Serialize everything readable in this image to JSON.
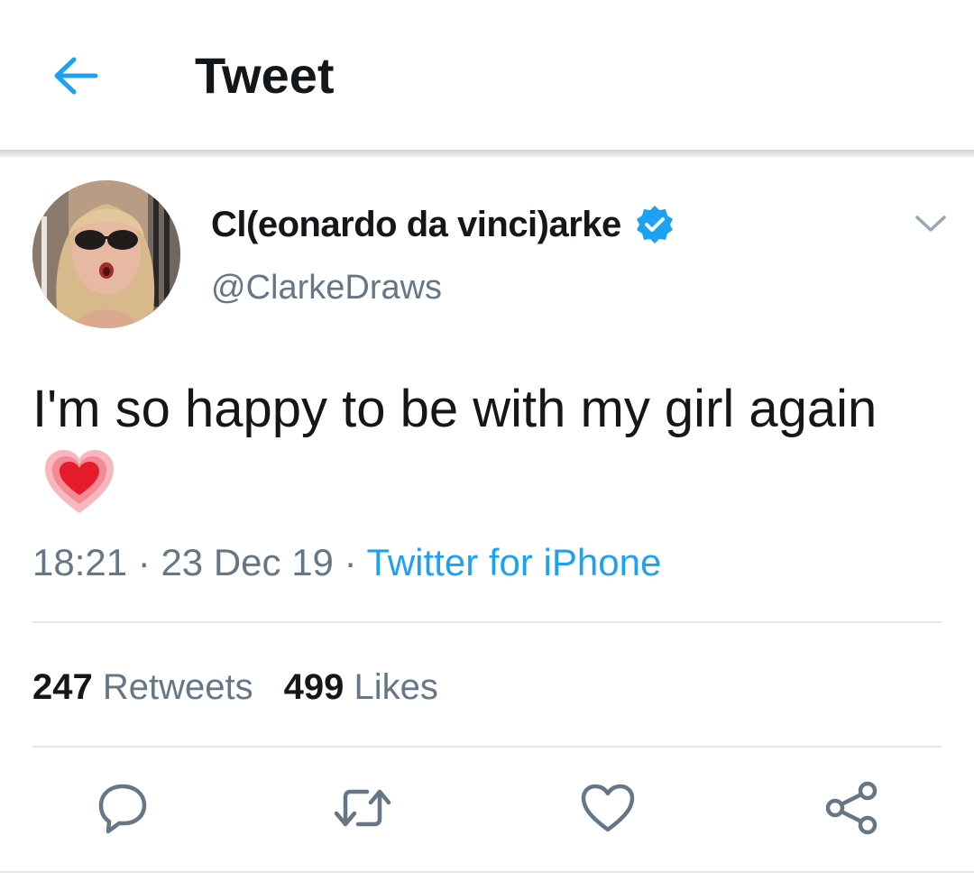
{
  "header": {
    "title": "Tweet",
    "back_icon": "arrow-left-icon"
  },
  "tweet": {
    "author": {
      "display_name": "Cl(eonardo da vinci)arke",
      "handle": "@ClarkeDraws",
      "verified": true
    },
    "text": "I'm so happy to be with my girl again",
    "emoji": "growing-heart-emoji",
    "time": "18:21",
    "separator": "·",
    "date": "23 Dec 19",
    "source": "Twitter for iPhone",
    "stats": {
      "retweets_count": "247",
      "retweets_label": "Retweets",
      "likes_count": "499",
      "likes_label": "Likes"
    }
  },
  "actions": [
    {
      "name": "reply",
      "icon": "reply-bubble-icon"
    },
    {
      "name": "retweet",
      "icon": "retweet-icon"
    },
    {
      "name": "like",
      "icon": "heart-icon"
    },
    {
      "name": "share",
      "icon": "share-icon"
    }
  ],
  "colors": {
    "accent": "#1da1f2",
    "text": "#14171a",
    "secondary": "#657786",
    "divider": "#e1e8ed"
  }
}
